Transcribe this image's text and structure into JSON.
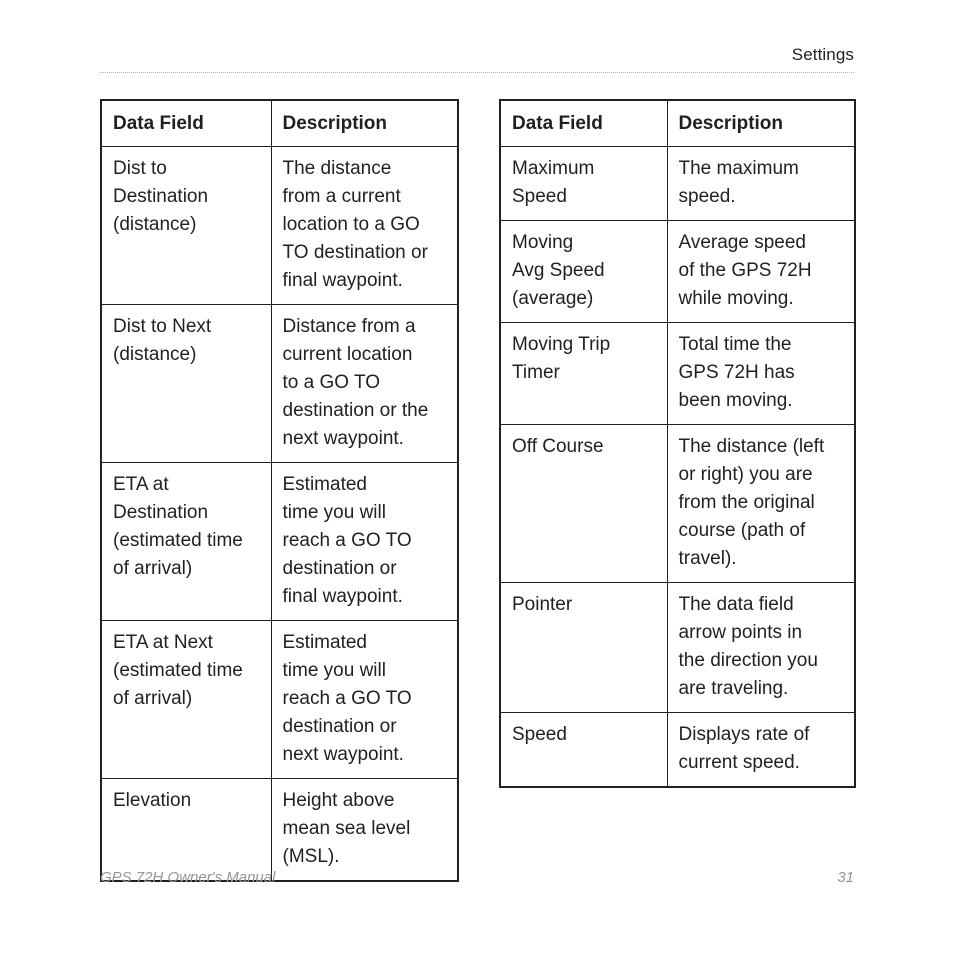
{
  "header": {
    "title": "Settings"
  },
  "footer": {
    "manual": "GPS 72H Owner's Manual",
    "page_number": "31"
  },
  "tables": {
    "left": {
      "columns": [
        "Data Field",
        "Description"
      ],
      "rows": [
        {
          "field": "Dist to\nDestination\n(distance)",
          "description": "The distance\nfrom a current\nlocation to a GO\nTO destination or\nfinal waypoint."
        },
        {
          "field": "Dist to Next\n(distance)",
          "description": "Distance from a\ncurrent location\nto a GO TO\ndestination or the\nnext waypoint."
        },
        {
          "field": "ETA at\nDestination\n(estimated time\nof arrival)",
          "description": "Estimated\ntime you will\nreach a GO TO\ndestination or\nfinal waypoint."
        },
        {
          "field": "ETA at Next\n(estimated time\nof arrival)",
          "description": "Estimated\ntime you will\nreach a GO TO\ndestination or\nnext waypoint."
        },
        {
          "field": "Elevation",
          "description": "Height above\nmean sea level\n(MSL)."
        }
      ]
    },
    "right": {
      "columns": [
        "Data Field",
        "Description"
      ],
      "rows": [
        {
          "field": "Maximum\nSpeed",
          "description": "The maximum\nspeed."
        },
        {
          "field": "Moving\nAvg Speed\n(average)",
          "description": "Average speed\nof the GPS 72H\nwhile moving."
        },
        {
          "field": "Moving Trip\nTimer",
          "description": "Total time the\nGPS 72H has\nbeen moving."
        },
        {
          "field": "Off Course",
          "description": "The distance (left\nor right) you are\nfrom the original\ncourse (path of\ntravel)."
        },
        {
          "field": "Pointer",
          "description": "The data field\narrow points in\nthe direction you\nare traveling."
        },
        {
          "field": "Speed",
          "description": "Displays rate of\ncurrent speed."
        }
      ]
    }
  }
}
